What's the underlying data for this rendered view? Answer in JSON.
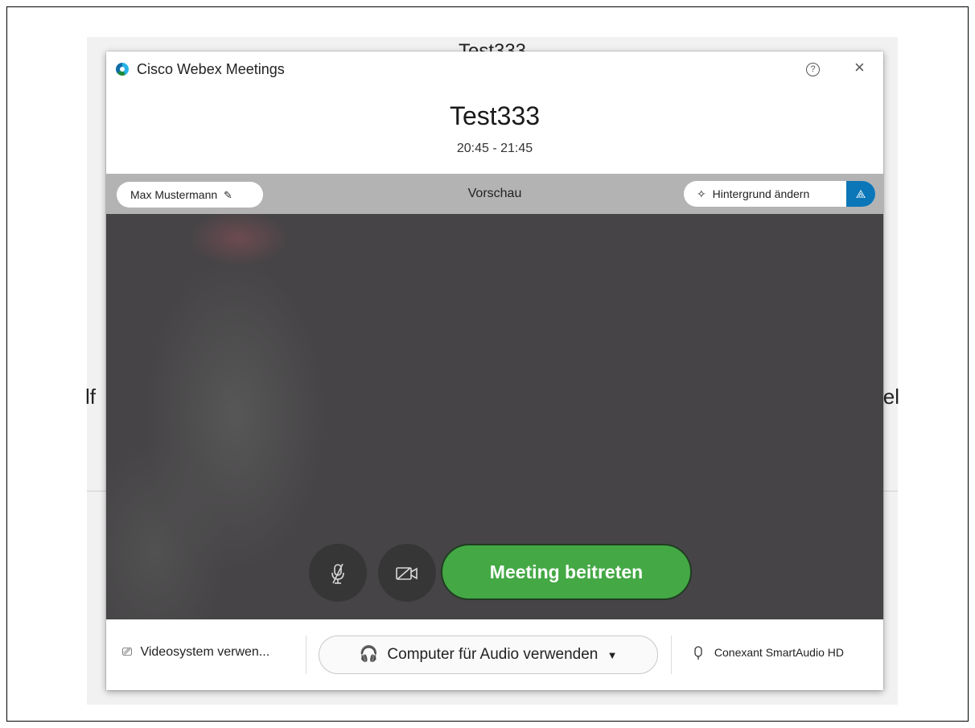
{
  "background": {
    "title": "Test333",
    "left_text": "lf",
    "right_text": "el"
  },
  "dialog": {
    "app_name": "Cisco Webex Meetings",
    "help_icon": "?",
    "close_icon": "×"
  },
  "meeting": {
    "title": "Test333",
    "time": "20:45 - 21:45"
  },
  "preview": {
    "user_name": "Max Mustermann",
    "label": "Vorschau",
    "change_background_label": "Hintergrund ändern"
  },
  "controls": {
    "join_label": "Meeting beitreten"
  },
  "footer": {
    "video_system_label": "Videosystem verwen...",
    "audio_label": "Computer für Audio verwenden",
    "mic_device": "Conexant SmartAudio HD"
  },
  "colors": {
    "join_green": "#44a845",
    "accent_blue": "#0b76b8",
    "video_bg": "#464446"
  },
  "icons": [
    "webex-logo-icon",
    "help-icon",
    "close-icon",
    "pencil-icon",
    "wand-icon",
    "blur-icon",
    "mic-off-icon",
    "camera-off-icon",
    "cast-icon",
    "headset-icon",
    "dropdown-icon",
    "mic-icon"
  ]
}
